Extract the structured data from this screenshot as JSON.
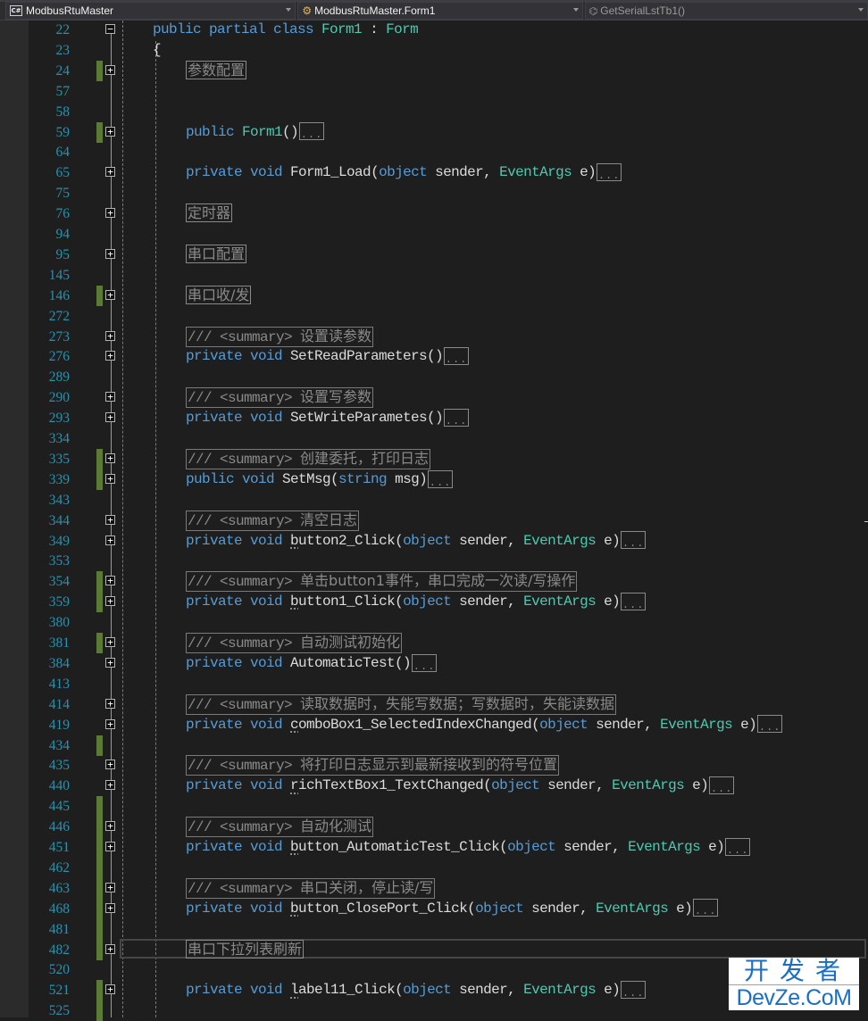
{
  "navbar": {
    "project": {
      "icon": "csharp-project-icon",
      "label": "ModbusRtuMaster"
    },
    "class": {
      "icon": "class-icon",
      "label": "ModbusRtuMaster.Form1"
    },
    "member": {
      "icon": "method-icon",
      "label": "GetSerialLstTb1()"
    }
  },
  "colors": {
    "keyword": "#569cd6",
    "type": "#4ec9b0",
    "identifier": "#dcdcdc",
    "line_number": "#2b91af",
    "collapsed_text": "#8a8a8a",
    "change_marker": "#5a7a35",
    "background": "#1e1e1e"
  },
  "lines": [
    {
      "n": "22",
      "fold": "minus",
      "chg": false,
      "indent": 1,
      "tokens": [
        [
          "kw",
          "public "
        ],
        [
          "kw",
          "partial "
        ],
        [
          "kw",
          "class "
        ],
        [
          "ty",
          "Form1"
        ],
        [
          "punc",
          " : "
        ],
        [
          "ty",
          "Form"
        ]
      ]
    },
    {
      "n": "23",
      "fold": "",
      "chg": false,
      "indent": 1,
      "tokens": [
        [
          "punc",
          "{"
        ]
      ]
    },
    {
      "n": "24",
      "fold": "plus",
      "chg": true,
      "indent": 2,
      "region": "参数配置"
    },
    {
      "n": "57",
      "fold": "",
      "chg": false,
      "indent": 2,
      "tokens": []
    },
    {
      "n": "58",
      "fold": "",
      "chg": false,
      "indent": 2,
      "tokens": []
    },
    {
      "n": "59",
      "fold": "plus",
      "chg": true,
      "indent": 2,
      "tokens": [
        [
          "kw",
          "public "
        ],
        [
          "ty",
          "Form1"
        ],
        [
          "punc",
          "()"
        ]
      ],
      "collapsed": true
    },
    {
      "n": "64",
      "fold": "",
      "chg": false,
      "indent": 2,
      "tokens": []
    },
    {
      "n": "65",
      "fold": "plus",
      "chg": false,
      "indent": 2,
      "tokens": [
        [
          "kw",
          "private "
        ],
        [
          "kw",
          "void "
        ],
        [
          "id",
          "Form1_Load"
        ],
        [
          "punc",
          "("
        ],
        [
          "kw",
          "object "
        ],
        [
          "id",
          "sender, "
        ],
        [
          "ty",
          "EventArgs "
        ],
        [
          "id",
          "e)"
        ]
      ],
      "collapsed": true
    },
    {
      "n": "75",
      "fold": "",
      "chg": false,
      "indent": 2,
      "tokens": []
    },
    {
      "n": "76",
      "fold": "plus",
      "chg": false,
      "indent": 2,
      "region": "定时器"
    },
    {
      "n": "94",
      "fold": "",
      "chg": false,
      "indent": 2,
      "tokens": []
    },
    {
      "n": "95",
      "fold": "plus",
      "chg": false,
      "indent": 2,
      "region": "串口配置"
    },
    {
      "n": "145",
      "fold": "",
      "chg": false,
      "indent": 2,
      "tokens": []
    },
    {
      "n": "146",
      "fold": "plus",
      "chg": true,
      "indent": 2,
      "region": "串口收/发"
    },
    {
      "n": "272",
      "fold": "",
      "chg": false,
      "indent": 2,
      "tokens": []
    },
    {
      "n": "273",
      "fold": "plus",
      "chg": false,
      "indent": 2,
      "doc": "设置读参数"
    },
    {
      "n": "276",
      "fold": "plus",
      "chg": false,
      "indent": 2,
      "tokens": [
        [
          "kw",
          "private "
        ],
        [
          "kw",
          "void "
        ],
        [
          "id",
          "SetReadParameters()"
        ]
      ],
      "collapsed": true
    },
    {
      "n": "289",
      "fold": "",
      "chg": false,
      "indent": 2,
      "tokens": []
    },
    {
      "n": "290",
      "fold": "plus",
      "chg": false,
      "indent": 2,
      "doc": "设置写参数"
    },
    {
      "n": "293",
      "fold": "plus",
      "chg": false,
      "indent": 2,
      "tokens": [
        [
          "kw",
          "private "
        ],
        [
          "kw",
          "void "
        ],
        [
          "id",
          "SetWriteParametes()"
        ]
      ],
      "collapsed": true
    },
    {
      "n": "334",
      "fold": "",
      "chg": false,
      "indent": 2,
      "tokens": []
    },
    {
      "n": "335",
      "fold": "plus",
      "chg": true,
      "indent": 2,
      "doc": "创建委托，打印日志"
    },
    {
      "n": "339",
      "fold": "plus",
      "chg": true,
      "indent": 2,
      "tokens": [
        [
          "kw",
          "public "
        ],
        [
          "kw",
          "void "
        ],
        [
          "id",
          "SetMsg("
        ],
        [
          "kw",
          "string "
        ],
        [
          "id",
          "msg)"
        ]
      ],
      "collapsed": true
    },
    {
      "n": "343",
      "fold": "",
      "chg": false,
      "indent": 2,
      "tokens": []
    },
    {
      "n": "344",
      "fold": "plus",
      "chg": false,
      "indent": 2,
      "doc": "清空日志"
    },
    {
      "n": "349",
      "fold": "plus",
      "chg": false,
      "indent": 2,
      "tokens": [
        [
          "kw",
          "private "
        ],
        [
          "kw",
          "void "
        ],
        [
          "dots",
          "b"
        ],
        [
          "id",
          "utton2_Click("
        ],
        [
          "kw",
          "object "
        ],
        [
          "id",
          "sender, "
        ],
        [
          "ty",
          "EventArgs "
        ],
        [
          "id",
          "e)"
        ]
      ],
      "collapsed": true
    },
    {
      "n": "353",
      "fold": "",
      "chg": false,
      "indent": 2,
      "tokens": []
    },
    {
      "n": "354",
      "fold": "plus",
      "chg": true,
      "indent": 2,
      "doc": "单击button1事件，串口完成一次读/写操作"
    },
    {
      "n": "359",
      "fold": "plus",
      "chg": true,
      "indent": 2,
      "tokens": [
        [
          "kw",
          "private "
        ],
        [
          "kw",
          "void "
        ],
        [
          "dots",
          "b"
        ],
        [
          "id",
          "utton1_Click("
        ],
        [
          "kw",
          "object "
        ],
        [
          "id",
          "sender, "
        ],
        [
          "ty",
          "EventArgs "
        ],
        [
          "id",
          "e)"
        ]
      ],
      "collapsed": true
    },
    {
      "n": "380",
      "fold": "",
      "chg": false,
      "indent": 2,
      "tokens": []
    },
    {
      "n": "381",
      "fold": "plus",
      "chg": true,
      "indent": 2,
      "doc": "自动测试初始化"
    },
    {
      "n": "384",
      "fold": "plus",
      "chg": false,
      "indent": 2,
      "tokens": [
        [
          "kw",
          "private "
        ],
        [
          "kw",
          "void "
        ],
        [
          "id",
          "AutomaticTest()"
        ]
      ],
      "collapsed": true
    },
    {
      "n": "413",
      "fold": "",
      "chg": false,
      "indent": 2,
      "tokens": []
    },
    {
      "n": "414",
      "fold": "plus",
      "chg": false,
      "indent": 2,
      "doc": "读取数据时，失能写数据；写数据时，失能读数据"
    },
    {
      "n": "419",
      "fold": "plus",
      "chg": false,
      "indent": 2,
      "tokens": [
        [
          "kw",
          "private "
        ],
        [
          "kw",
          "void "
        ],
        [
          "dots",
          "c"
        ],
        [
          "id",
          "omboBox1_SelectedIndexChanged("
        ],
        [
          "kw",
          "object "
        ],
        [
          "id",
          "sender, "
        ],
        [
          "ty",
          "EventArgs "
        ],
        [
          "id",
          "e)"
        ]
      ],
      "collapsed": true
    },
    {
      "n": "434",
      "fold": "",
      "chg": true,
      "indent": 2,
      "tokens": []
    },
    {
      "n": "435",
      "fold": "plus",
      "chg": false,
      "indent": 2,
      "doc": "将打印日志显示到最新接收到的符号位置"
    },
    {
      "n": "440",
      "fold": "plus",
      "chg": false,
      "indent": 2,
      "tokens": [
        [
          "kw",
          "private "
        ],
        [
          "kw",
          "void "
        ],
        [
          "dots",
          "r"
        ],
        [
          "id",
          "ichTextBox1_TextChanged("
        ],
        [
          "kw",
          "object "
        ],
        [
          "id",
          "sender, "
        ],
        [
          "ty",
          "EventArgs "
        ],
        [
          "id",
          "e)"
        ]
      ],
      "collapsed": true
    },
    {
      "n": "445",
      "fold": "",
      "chg": true,
      "indent": 2,
      "tokens": []
    },
    {
      "n": "446",
      "fold": "plus",
      "chg": true,
      "indent": 2,
      "doc": "自动化测试"
    },
    {
      "n": "451",
      "fold": "plus",
      "chg": true,
      "indent": 2,
      "tokens": [
        [
          "kw",
          "private "
        ],
        [
          "kw",
          "void "
        ],
        [
          "dots",
          "b"
        ],
        [
          "id",
          "utton_AutomaticTest_Click("
        ],
        [
          "kw",
          "object "
        ],
        [
          "id",
          "sender, "
        ],
        [
          "ty",
          "EventArgs "
        ],
        [
          "id",
          "e)"
        ]
      ],
      "collapsed": true
    },
    {
      "n": "462",
      "fold": "",
      "chg": true,
      "indent": 2,
      "tokens": []
    },
    {
      "n": "463",
      "fold": "plus",
      "chg": true,
      "indent": 2,
      "doc": "串口关闭，停止读/写"
    },
    {
      "n": "468",
      "fold": "plus",
      "chg": true,
      "indent": 2,
      "tokens": [
        [
          "kw",
          "private "
        ],
        [
          "kw",
          "void "
        ],
        [
          "dots",
          "b"
        ],
        [
          "id",
          "utton_ClosePort_Click("
        ],
        [
          "kw",
          "object "
        ],
        [
          "id",
          "sender, "
        ],
        [
          "ty",
          "EventArgs "
        ],
        [
          "id",
          "e)"
        ]
      ],
      "collapsed": true
    },
    {
      "n": "481",
      "fold": "",
      "chg": true,
      "indent": 2,
      "tokens": []
    },
    {
      "n": "482",
      "fold": "plus",
      "chg": true,
      "indent": 2,
      "region": "串口下拉列表刷新"
    },
    {
      "n": "520",
      "fold": "",
      "chg": false,
      "indent": 2,
      "tokens": []
    },
    {
      "n": "521",
      "fold": "plus",
      "chg": true,
      "indent": 2,
      "tokens": [
        [
          "kw",
          "private "
        ],
        [
          "kw",
          "void "
        ],
        [
          "dots",
          "l"
        ],
        [
          "id",
          "abel11_Click("
        ],
        [
          "kw",
          "object "
        ],
        [
          "id",
          "sender, "
        ],
        [
          "ty",
          "EventArgs "
        ],
        [
          "id",
          "e)"
        ]
      ],
      "collapsed": true
    },
    {
      "n": "525",
      "fold": "",
      "chg": true,
      "indent": 2,
      "tokens": []
    }
  ],
  "doc_prefix": "/// <summary> ",
  "collapsed_marker": "...",
  "watermark": {
    "top": "开发者",
    "bottom": "DevZe.CoM"
  }
}
